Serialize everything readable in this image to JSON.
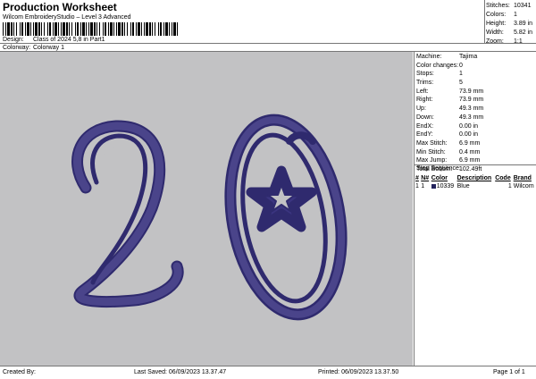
{
  "header": {
    "title": "Production Worksheet",
    "subtitle": "Wilcom EmbroideryStudio – Level 3 Advanced"
  },
  "design": {
    "label": "Design:",
    "value": "Class of 2024 5,8 in Part1"
  },
  "colorway": {
    "label": "Colorway:",
    "value": "Colorway 1"
  },
  "summary": [
    {
      "label": "Stitches:",
      "value": "10341"
    },
    {
      "label": "Colors:",
      "value": "1"
    },
    {
      "label": "Height:",
      "value": "3.89 in"
    },
    {
      "label": "Width:",
      "value": "5.82 in"
    },
    {
      "label": "Zoom:",
      "value": "1:1"
    }
  ],
  "details": [
    {
      "label": "Machine:",
      "value": "Tajima"
    },
    {
      "label": "Color changes:",
      "value": "0"
    },
    {
      "label": "Stops:",
      "value": "1"
    },
    {
      "label": "Trims:",
      "value": "5"
    },
    {
      "label": "Left:",
      "value": "73.9 mm"
    },
    {
      "label": "Right:",
      "value": "73.9 mm"
    },
    {
      "label": "Up:",
      "value": "49.3 mm"
    },
    {
      "label": "Down:",
      "value": "49.3 mm"
    },
    {
      "label": "EndX:",
      "value": "0.00 in"
    },
    {
      "label": "EndY:",
      "value": "0.00 in"
    },
    {
      "label": "Max Stitch:",
      "value": "6.9 mm"
    },
    {
      "label": "Min Stitch:",
      "value": "0.4 mm"
    },
    {
      "label": "Max Jump:",
      "value": "6.9 mm"
    },
    {
      "label": "Total Bobbin:",
      "value": "102.49ft"
    }
  ],
  "stop_sequence": {
    "title": "Stop Sequence:",
    "headers": {
      "stop": "#",
      "n": "N#",
      "color": "Color",
      "description": "Description",
      "code": "Code",
      "brand": "Brand"
    },
    "rows": [
      {
        "stop": "1",
        "n": "1",
        "color": "10339",
        "description": "Blue",
        "code": "1",
        "brand": "Wilcom",
        "swatch": "#23235c"
      }
    ]
  },
  "footer": {
    "created": "Created By:",
    "last_saved": "Last Saved: 06/09/2023 13.37.47",
    "printed": "Printed: 06/09/2023 13.37.50",
    "page": "Page 1 of 1"
  },
  "colors": {
    "canvas": "#c2c2c4",
    "thread": "#2f2a6e",
    "thread_light": "#5b5599"
  }
}
